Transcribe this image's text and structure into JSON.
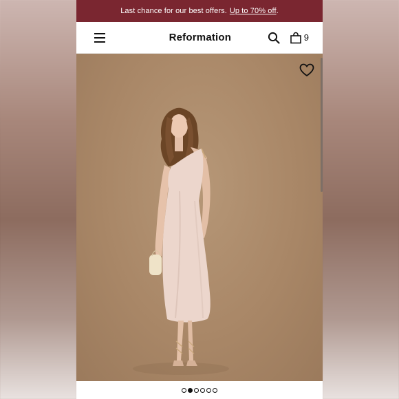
{
  "promo": {
    "text": "Last chance for our best offers.",
    "link": "Up to 70% off",
    "suffix": "."
  },
  "header": {
    "brand": "Reformation",
    "bag_count": "9"
  },
  "icons": {
    "menu": "hamburger-icon",
    "search": "search-icon",
    "bag": "shopping-bag-icon",
    "wishlist": "heart-icon"
  },
  "colors": {
    "promo_bar": "#7a2630",
    "backdrop": "#a98767",
    "dress": "#ecd6cc"
  },
  "carousel": {
    "count": 6,
    "active_index": 1
  }
}
